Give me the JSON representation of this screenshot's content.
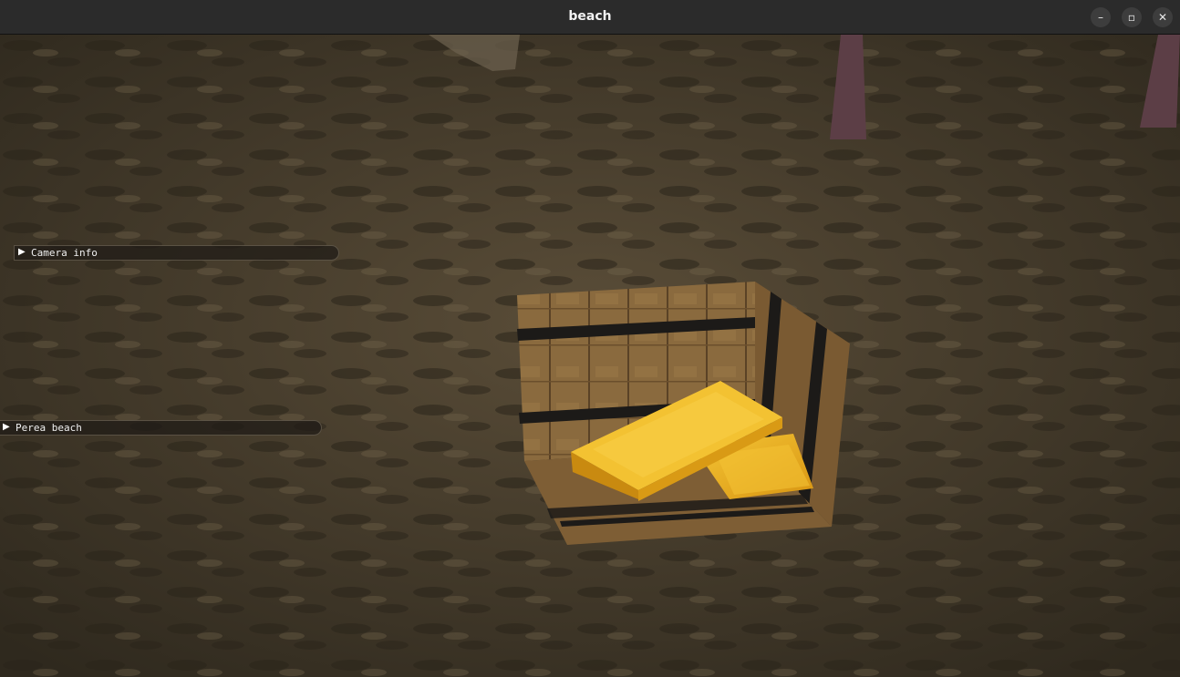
{
  "window": {
    "title": "beach",
    "minimize_glyph": "–",
    "maximize_glyph": "▫",
    "close_glyph": "✕"
  },
  "panels": {
    "camera_info": {
      "label": "Camera info",
      "arrow": "▶"
    },
    "perea_beach": {
      "label": "Perea beach",
      "arrow": "▶"
    }
  },
  "scene": {
    "sand_color": "#4a4030",
    "crate_wood_color": "#8a6a3e",
    "crate_band_color": "#1c1a18",
    "gold_color": "#e8b020"
  }
}
